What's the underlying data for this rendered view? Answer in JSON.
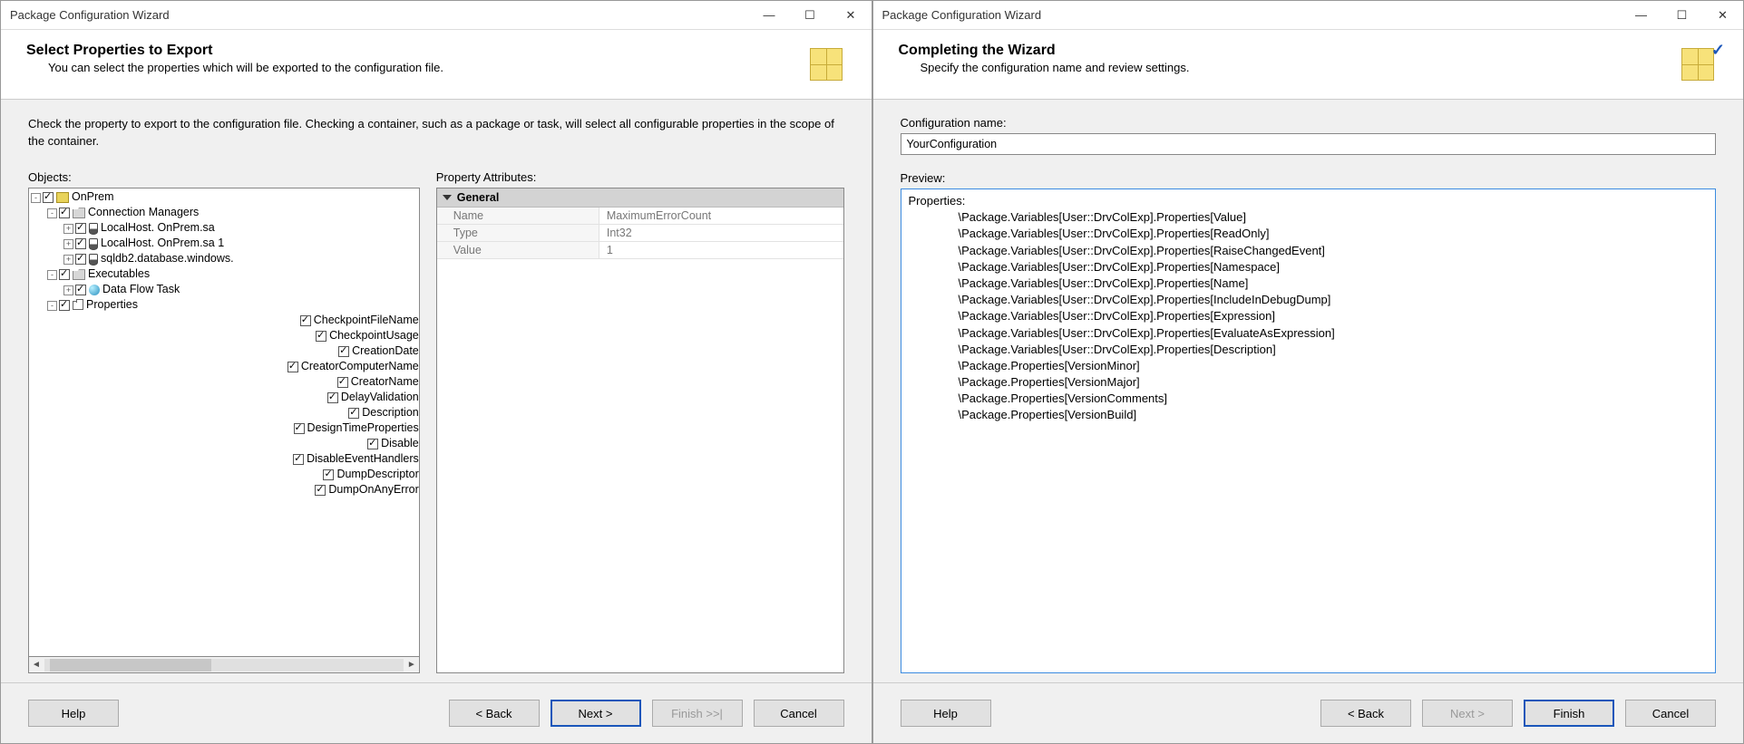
{
  "left": {
    "window_title": "Package Configuration Wizard",
    "header_title": "Select Properties to Export",
    "header_sub": "You can select the properties which will be exported to the configuration file.",
    "intro": "Check the property to export to the configuration file. Checking a container, such as a package or task, will select all configurable properties in the scope of the container.",
    "objects_label": "Objects:",
    "attrs_label": "Property Attributes:",
    "tree": [
      {
        "depth": 0,
        "exp": "-",
        "cb": true,
        "icon": "pkg",
        "text": "OnPrem"
      },
      {
        "depth": 1,
        "exp": "-",
        "cb": true,
        "icon": "folder",
        "text": "Connection Managers"
      },
      {
        "depth": 2,
        "exp": "+",
        "cb": true,
        "icon": "conn",
        "text": "LocalHost.             OnPrem.sa"
      },
      {
        "depth": 2,
        "exp": "+",
        "cb": true,
        "icon": "conn",
        "text": "LocalHost.             OnPrem.sa 1"
      },
      {
        "depth": 2,
        "exp": "+",
        "cb": true,
        "icon": "conn",
        "text": "              sqldb2.database.windows."
      },
      {
        "depth": 1,
        "exp": "-",
        "cb": true,
        "icon": "folder",
        "text": "Executables"
      },
      {
        "depth": 2,
        "exp": "+",
        "cb": true,
        "icon": "flow",
        "text": "Data Flow Task"
      },
      {
        "depth": 1,
        "exp": "-",
        "cb": true,
        "icon": "props",
        "text": "Properties"
      },
      {
        "depth": 2,
        "exp": " ",
        "cb": true,
        "icon": "",
        "text": "CheckpointFileName"
      },
      {
        "depth": 2,
        "exp": " ",
        "cb": true,
        "icon": "",
        "text": "CheckpointUsage"
      },
      {
        "depth": 2,
        "exp": " ",
        "cb": true,
        "icon": "",
        "text": "CreationDate"
      },
      {
        "depth": 2,
        "exp": " ",
        "cb": true,
        "icon": "",
        "text": "CreatorComputerName"
      },
      {
        "depth": 2,
        "exp": " ",
        "cb": true,
        "icon": "",
        "text": "CreatorName"
      },
      {
        "depth": 2,
        "exp": " ",
        "cb": true,
        "icon": "",
        "text": "DelayValidation"
      },
      {
        "depth": 2,
        "exp": " ",
        "cb": true,
        "icon": "",
        "text": "Description"
      },
      {
        "depth": 2,
        "exp": " ",
        "cb": true,
        "icon": "",
        "text": "DesignTimeProperties"
      },
      {
        "depth": 2,
        "exp": " ",
        "cb": true,
        "icon": "",
        "text": "Disable"
      },
      {
        "depth": 2,
        "exp": " ",
        "cb": true,
        "icon": "",
        "text": "DisableEventHandlers"
      },
      {
        "depth": 2,
        "exp": " ",
        "cb": true,
        "icon": "",
        "text": "DumpDescriptor"
      },
      {
        "depth": 2,
        "exp": " ",
        "cb": true,
        "icon": "",
        "text": "DumpOnAnyError"
      }
    ],
    "attr_group": "General",
    "attrs": [
      {
        "name": "Name",
        "value": "MaximumErrorCount"
      },
      {
        "name": "Type",
        "value": "Int32"
      },
      {
        "name": "Value",
        "value": "1"
      }
    ],
    "buttons": {
      "help": "Help",
      "back": "< Back",
      "next": "Next >",
      "finish": "Finish >>|",
      "cancel": "Cancel"
    }
  },
  "right": {
    "window_title": "Package Configuration Wizard",
    "header_title": "Completing the Wizard",
    "header_sub": "Specify the configuration name and review settings.",
    "config_name_label": "Configuration name:",
    "config_name_value": "YourConfiguration",
    "preview_label": "Preview:",
    "preview_header": "Properties:",
    "preview_lines": [
      "\\Package.Variables[User::DrvColExp].Properties[Value]",
      "\\Package.Variables[User::DrvColExp].Properties[ReadOnly]",
      "\\Package.Variables[User::DrvColExp].Properties[RaiseChangedEvent]",
      "\\Package.Variables[User::DrvColExp].Properties[Namespace]",
      "\\Package.Variables[User::DrvColExp].Properties[Name]",
      "\\Package.Variables[User::DrvColExp].Properties[IncludeInDebugDump]",
      "\\Package.Variables[User::DrvColExp].Properties[Expression]",
      "\\Package.Variables[User::DrvColExp].Properties[EvaluateAsExpression]",
      "\\Package.Variables[User::DrvColExp].Properties[Description]",
      "\\Package.Properties[VersionMinor]",
      "\\Package.Properties[VersionMajor]",
      "\\Package.Properties[VersionComments]",
      "\\Package.Properties[VersionBuild]"
    ],
    "buttons": {
      "help": "Help",
      "back": "< Back",
      "next": "Next >",
      "finish": "Finish",
      "cancel": "Cancel"
    }
  }
}
